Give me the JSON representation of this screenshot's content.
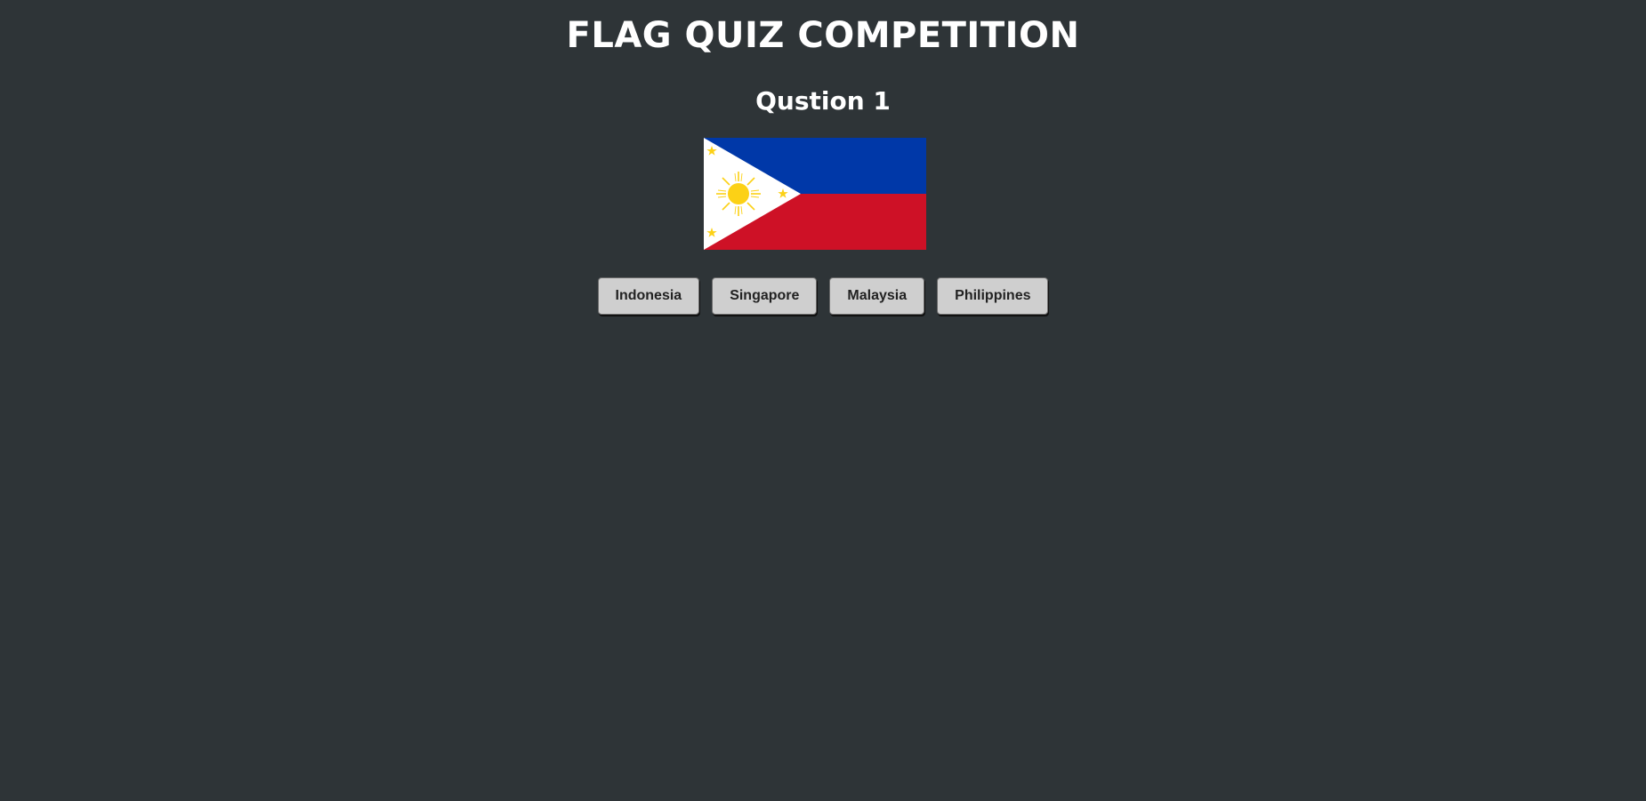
{
  "header": {
    "title": "FLAG QUIZ COMPETITION",
    "question_label": "Qustion 1"
  },
  "flag": {
    "icon": "philippines-flag-icon",
    "colors": {
      "blue": "#0038a8",
      "red": "#ce1126",
      "white": "#ffffff",
      "gold": "#fcd116"
    }
  },
  "options": [
    {
      "label": "Indonesia"
    },
    {
      "label": "Singapore"
    },
    {
      "label": "Malaysia"
    },
    {
      "label": "Philippines"
    }
  ],
  "theme": {
    "background": "#2e3437",
    "button_bg": "#cfcfcf",
    "text": "#ffffff"
  }
}
